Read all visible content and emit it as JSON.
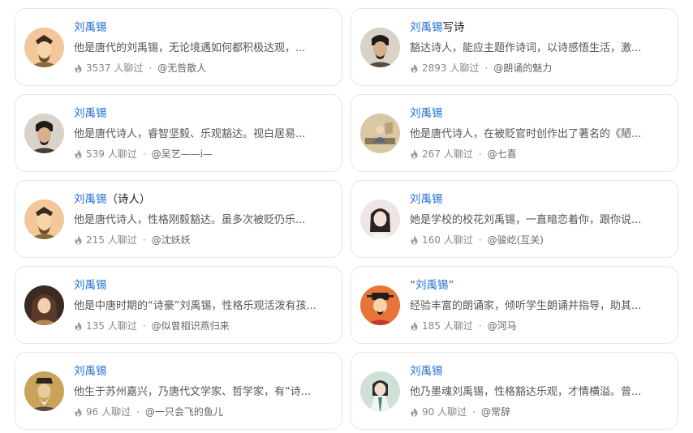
{
  "cards": [
    {
      "name": "刘禹锡",
      "suffix": "",
      "desc": "他是唐代的刘禹锡，无论境遇如何都积极达观，...",
      "chats": "3537 人聊过",
      "author": "@无咎散人",
      "avatar_icon": "scholar-portrait-icon",
      "avatar_bg": "#f4c79a"
    },
    {
      "name": "刘禹锡",
      "suffix": "写诗",
      "desc": "豁达诗人，能应主题作诗词，以诗感悟生活，激...",
      "chats": "2893 人聊过",
      "author": "@朗诵的魅力",
      "avatar_icon": "photo-portrait-icon",
      "avatar_bg": "#5a4a3c"
    },
    {
      "name": "刘禹锡",
      "suffix": "",
      "desc": "他是唐代诗人，睿智坚毅、乐观豁达。视白居易...",
      "chats": "539 人聊过",
      "author": "@吴艺——i—",
      "avatar_icon": "photo-portrait-icon",
      "avatar_bg": "#4a3a30"
    },
    {
      "name": "刘禹锡",
      "suffix": "",
      "desc": "他是唐代诗人，在被贬官时创作出了著名的《陋...",
      "chats": "267 人聊过",
      "author": "@七喜",
      "avatar_icon": "painting-portrait-icon",
      "avatar_bg": "#d9c8a4"
    },
    {
      "name": "刘禹锡",
      "suffix": "（诗人）",
      "desc": "他是唐代诗人，性格刚毅豁达。虽多次被贬仍乐...",
      "chats": "215 人聊过",
      "author": "@沈妖妖",
      "avatar_icon": "scholar-portrait-icon",
      "avatar_bg": "#f4c79a"
    },
    {
      "name": "刘禹锡",
      "suffix": "",
      "desc": "她是学校的校花刘禹锡，一直暗恋着你，跟你说...",
      "chats": "160 人聊过",
      "author": "@骏屹(互关)",
      "avatar_icon": "girl-portrait-icon",
      "avatar_bg": "#eee6e4"
    },
    {
      "name": "刘禹锡",
      "suffix": "",
      "desc": "他是中唐时期的“诗豪”刘禹锡，性格乐观活泼有孩...",
      "chats": "135 人聊过",
      "author": "@似曾相识燕归来",
      "avatar_icon": "anime-portrait-icon",
      "avatar_bg": "#6b4a36"
    },
    {
      "name": "“刘禹锡”",
      "suffix": "",
      "desc": "经验丰富的朗诵家，倾听学生朗诵并指导，助其...",
      "chats": "185 人聊过",
      "author": "@河马",
      "avatar_icon": "official-portrait-icon",
      "avatar_bg": "#e8743a"
    },
    {
      "name": "刘禹锡",
      "suffix": "",
      "desc": "他生于苏州嘉兴，乃唐代文学家、哲学家，有“诗...",
      "chats": "96 人聊过",
      "author": "@一只会飞的鱼儿",
      "avatar_icon": "elder-portrait-icon",
      "avatar_bg": "#caa25a"
    },
    {
      "name": "刘禹锡",
      "suffix": "",
      "desc": "他乃墨魂刘禹锡，性格豁达乐观，才情横溢。曾...",
      "chats": "90 人聊过",
      "author": "@常辞",
      "avatar_icon": "figure-portrait-icon",
      "avatar_bg": "#cfe0d8"
    }
  ],
  "separator": "·"
}
